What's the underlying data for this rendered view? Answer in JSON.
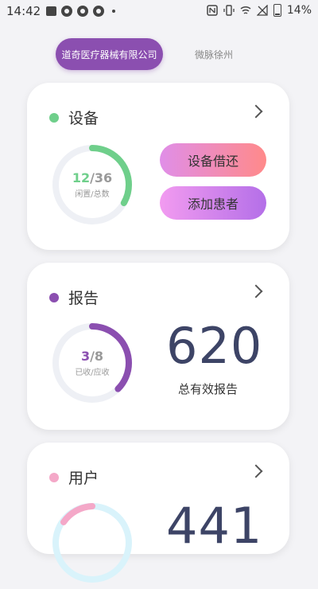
{
  "status_bar": {
    "time": "14:42",
    "battery": "14%",
    "icons": [
      "image-icon",
      "q-app-icon",
      "q-app-icon",
      "q-app-icon",
      "dot-icon",
      "nfc-icon",
      "vibrate-icon",
      "wifi-icon",
      "no-signal-icon",
      "battery-icon"
    ]
  },
  "tabs": {
    "active": "道奇医疗器械有限公司",
    "inactive": "微脉徐州"
  },
  "device_card": {
    "title": "设备",
    "dot_color": "#6fcf8b",
    "idle": "12",
    "total": "36",
    "progress": 0.333,
    "caption": "闲置/总数",
    "borrow_button": "设备借还",
    "add_patient_button": "添加患者"
  },
  "report_card": {
    "title": "报告",
    "dot_color": "#8b4fb0",
    "received": "3",
    "due": "8",
    "progress": 0.375,
    "caption": "已收/应收",
    "total_reports": "620",
    "total_caption": "总有效报告"
  },
  "user_card": {
    "title": "用户",
    "dot_color": "#f4a8c8",
    "big_number_partial": "441"
  },
  "colors": {
    "accent_purple": "#8b4fb0",
    "green": "#6fcf8b",
    "pink": "#f4a8c8",
    "number_navy": "#3d4466"
  }
}
